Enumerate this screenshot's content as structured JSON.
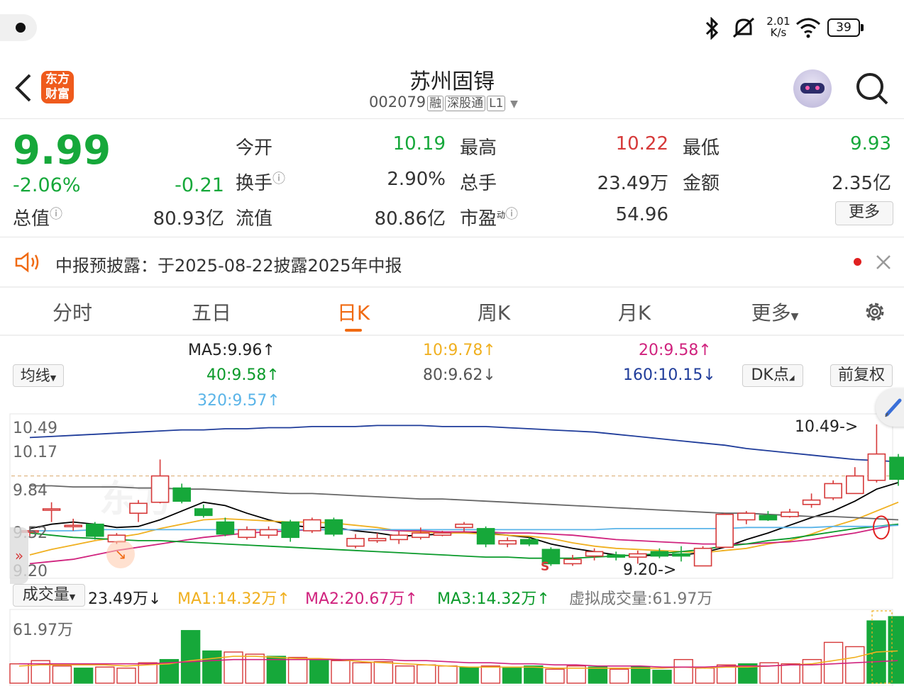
{
  "status_bar": {
    "net_speed_value": "2.01",
    "net_speed_unit": "K/s",
    "battery": "39"
  },
  "header": {
    "logo_line1": "东方",
    "logo_line2": "财富",
    "title": "苏州固锝",
    "code": "002079",
    "tags": [
      "融",
      "深股通",
      "L1"
    ]
  },
  "quote": {
    "price": "9.99",
    "change_pct": "-2.06%",
    "change_abs": "-0.21",
    "open_label": "今开",
    "open": "10.19",
    "high_label": "最高",
    "high": "10.22",
    "low_label": "最低",
    "low": "9.93",
    "turnover_label": "换手",
    "turnover": "2.90%",
    "volume_label": "总手",
    "volume": "23.49万",
    "amount_label": "金额",
    "amount": "2.35亿",
    "mktcap_label": "总值",
    "mktcap": "80.93亿",
    "float_label": "流值",
    "float_cap": "80.86亿",
    "pe_label": "市盈",
    "pe_sup": "动",
    "pe": "54.96",
    "more_label": "更多"
  },
  "notice": {
    "text": "中报预披露：于2025-08-22披露2025年中报"
  },
  "tabs": [
    "分时",
    "五日",
    "日K",
    "周K",
    "月K",
    "更多"
  ],
  "active_tab": "日K",
  "ma_panel": {
    "selector": "均线",
    "ma5": "MA5:9.96",
    "ma10": "10:9.78",
    "ma20": "20:9.58",
    "ma40": "40:9.58",
    "ma80": "80:9.62",
    "ma160": "160:10.15",
    "ma320": "320:9.57",
    "dk_button": "DK点",
    "adjust_button": "前复权"
  },
  "price_axis": [
    "10.49",
    "10.17",
    "9.84",
    "9.52",
    "9.20"
  ],
  "annotations": {
    "high_marker": "10.49->",
    "low_marker": "9.20->",
    "signal": "S"
  },
  "volume_header": {
    "selector": "成交量",
    "vol": "23.49万",
    "ma1": "MA1:14.32万",
    "ma2": "MA2:20.67万",
    "ma3": "MA3:14.32万",
    "virtual": "虚拟成交量:61.97万"
  },
  "volume_axis_max": "61.97万",
  "colors": {
    "up": "#d63a3a",
    "down": "#16a83a",
    "accent": "#f06a12",
    "ma5": "#000000",
    "ma10": "#f0b020",
    "ma20": "#d0237e",
    "ma40": "#0a9a2a",
    "ma80": "#666666",
    "ma160": "#1f3c9a",
    "ma320": "#5ab4e8"
  },
  "chart_data": {
    "type": "candlestick",
    "ylim": [
      9.1,
      10.56
    ],
    "candles": [
      {
        "o": 9.52,
        "c": 9.52,
        "h": 9.56,
        "l": 9.47
      },
      {
        "o": 9.72,
        "c": 9.72,
        "h": 9.78,
        "l": 9.6
      },
      {
        "o": 9.57,
        "c": 9.57,
        "h": 9.63,
        "l": 9.52
      },
      {
        "o": 9.58,
        "c": 9.47,
        "h": 9.6,
        "l": 9.44
      },
      {
        "o": 9.42,
        "c": 9.48,
        "h": 9.5,
        "l": 9.4
      },
      {
        "o": 9.68,
        "c": 9.77,
        "h": 9.8,
        "l": 9.6
      },
      {
        "o": 9.78,
        "c": 10.02,
        "h": 10.17,
        "l": 9.77
      },
      {
        "o": 9.91,
        "c": 9.79,
        "h": 9.95,
        "l": 9.77
      },
      {
        "o": 9.72,
        "c": 9.66,
        "h": 9.76,
        "l": 9.64
      },
      {
        "o": 9.6,
        "c": 9.49,
        "h": 9.64,
        "l": 9.47
      },
      {
        "o": 9.46,
        "c": 9.53,
        "h": 9.56,
        "l": 9.44
      },
      {
        "o": 9.48,
        "c": 9.53,
        "h": 9.56,
        "l": 9.45
      },
      {
        "o": 9.6,
        "c": 9.46,
        "h": 9.62,
        "l": 9.42
      },
      {
        "o": 9.52,
        "c": 9.62,
        "h": 9.64,
        "l": 9.5
      },
      {
        "o": 9.62,
        "c": 9.49,
        "h": 9.64,
        "l": 9.47
      },
      {
        "o": 9.38,
        "c": 9.45,
        "h": 9.49,
        "l": 9.36
      },
      {
        "o": 9.43,
        "c": 9.45,
        "h": 9.5,
        "l": 9.41
      },
      {
        "o": 9.44,
        "c": 9.48,
        "h": 9.52,
        "l": 9.4
      },
      {
        "o": 9.46,
        "c": 9.5,
        "h": 9.55,
        "l": 9.44
      },
      {
        "o": 9.48,
        "c": 9.5,
        "h": 9.52,
        "l": 9.47
      },
      {
        "o": 9.55,
        "c": 9.58,
        "h": 9.6,
        "l": 9.51
      },
      {
        "o": 9.54,
        "c": 9.4,
        "h": 9.56,
        "l": 9.37
      },
      {
        "o": 9.4,
        "c": 9.43,
        "h": 9.46,
        "l": 9.37
      },
      {
        "o": 9.44,
        "c": 9.4,
        "h": 9.46,
        "l": 9.38
      },
      {
        "o": 9.35,
        "c": 9.22,
        "h": 9.37,
        "l": 9.2
      },
      {
        "o": 9.22,
        "c": 9.26,
        "h": 9.3,
        "l": 9.2
      },
      {
        "o": 9.29,
        "c": 9.33,
        "h": 9.36,
        "l": 9.25
      },
      {
        "o": 9.3,
        "c": 9.28,
        "h": 9.33,
        "l": 9.25
      },
      {
        "o": 9.28,
        "c": 9.31,
        "h": 9.34,
        "l": 9.22
      },
      {
        "o": 9.33,
        "c": 9.29,
        "h": 9.36,
        "l": 9.27
      },
      {
        "o": 9.31,
        "c": 9.29,
        "h": 9.38,
        "l": 9.24
      },
      {
        "o": 9.2,
        "c": 9.36,
        "h": 9.38,
        "l": 9.2
      },
      {
        "o": 9.37,
        "c": 9.67,
        "h": 9.68,
        "l": 9.37
      },
      {
        "o": 9.62,
        "c": 9.68,
        "h": 9.7,
        "l": 9.58
      },
      {
        "o": 9.66,
        "c": 9.62,
        "h": 9.7,
        "l": 9.61
      },
      {
        "o": 9.65,
        "c": 9.69,
        "h": 9.72,
        "l": 9.64
      },
      {
        "o": 9.76,
        "c": 9.8,
        "h": 9.86,
        "l": 9.73
      },
      {
        "o": 9.82,
        "c": 9.95,
        "h": 9.98,
        "l": 9.8
      },
      {
        "o": 9.86,
        "c": 10.02,
        "h": 10.1,
        "l": 9.86
      },
      {
        "o": 9.98,
        "c": 10.22,
        "h": 10.49,
        "l": 9.96
      },
      {
        "o": 10.19,
        "c": 9.99,
        "h": 10.22,
        "l": 9.93
      }
    ],
    "ma_lines": {
      "ma5": [
        9.54,
        9.58,
        9.6,
        9.58,
        9.55,
        9.56,
        9.62,
        9.7,
        9.78,
        9.75,
        9.68,
        9.62,
        9.57,
        9.55,
        9.55,
        9.52,
        9.5,
        9.47,
        9.48,
        9.49,
        9.51,
        9.5,
        9.48,
        9.46,
        9.4,
        9.36,
        9.33,
        9.3,
        9.29,
        9.3,
        9.3,
        9.32,
        9.37,
        9.44,
        9.5,
        9.57,
        9.64,
        9.7,
        9.79,
        9.9,
        9.96
      ],
      "ma10": [
        9.3,
        9.35,
        9.39,
        9.43,
        9.46,
        9.49,
        9.54,
        9.58,
        9.62,
        9.63,
        9.62,
        9.61,
        9.6,
        9.6,
        9.59,
        9.57,
        9.55,
        9.52,
        9.51,
        9.5,
        9.5,
        9.49,
        9.48,
        9.47,
        9.45,
        9.41,
        9.38,
        9.36,
        9.35,
        9.34,
        9.33,
        9.32,
        9.34,
        9.36,
        9.4,
        9.43,
        9.49,
        9.56,
        9.62,
        9.7,
        9.78
      ],
      "ma20": [
        9.22,
        9.24,
        9.26,
        9.3,
        9.34,
        9.37,
        9.4,
        9.43,
        9.46,
        9.48,
        9.5,
        9.51,
        9.52,
        9.53,
        9.53,
        9.53,
        9.53,
        9.52,
        9.52,
        9.51,
        9.51,
        9.51,
        9.5,
        9.5,
        9.49,
        9.48,
        9.46,
        9.44,
        9.43,
        9.42,
        9.41,
        9.4,
        9.4,
        9.4,
        9.41,
        9.42,
        9.44,
        9.47,
        9.5,
        9.54,
        9.58
      ],
      "ma40": [
        9.5,
        9.48,
        9.46,
        9.45,
        9.44,
        9.43,
        9.43,
        9.42,
        9.41,
        9.4,
        9.39,
        9.38,
        9.37,
        9.36,
        9.35,
        9.34,
        9.33,
        9.32,
        9.31,
        9.3,
        9.29,
        9.28,
        9.28,
        9.27,
        9.27,
        9.27,
        9.28,
        9.29,
        9.3,
        9.31,
        9.33,
        9.35,
        9.38,
        9.4,
        9.43,
        9.45,
        9.48,
        9.51,
        9.54,
        9.56,
        9.58
      ],
      "ma80": [
        9.93,
        9.93,
        9.92,
        9.92,
        9.92,
        9.91,
        9.91,
        9.9,
        9.9,
        9.89,
        9.88,
        9.87,
        9.86,
        9.86,
        9.85,
        9.84,
        9.83,
        9.82,
        9.81,
        9.81,
        9.8,
        9.79,
        9.78,
        9.77,
        9.76,
        9.75,
        9.74,
        9.73,
        9.72,
        9.71,
        9.7,
        9.69,
        9.68,
        9.68,
        9.67,
        9.66,
        9.65,
        9.65,
        9.64,
        9.63,
        9.62
      ],
      "ma160": [
        10.37,
        10.38,
        10.39,
        10.4,
        10.41,
        10.42,
        10.43,
        10.44,
        10.44,
        10.45,
        10.45,
        10.46,
        10.46,
        10.47,
        10.47,
        10.47,
        10.48,
        10.48,
        10.48,
        10.47,
        10.47,
        10.47,
        10.46,
        10.45,
        10.44,
        10.43,
        10.42,
        10.4,
        10.38,
        10.36,
        10.34,
        10.32,
        10.3,
        10.27,
        10.25,
        10.23,
        10.21,
        10.19,
        10.17,
        10.16,
        10.15
      ],
      "ma320": [
        9.52,
        9.52,
        9.52,
        9.53,
        9.53,
        9.53,
        9.53,
        9.53,
        9.53,
        9.53,
        9.53,
        9.53,
        9.53,
        9.53,
        9.53,
        9.53,
        9.53,
        9.53,
        9.53,
        9.53,
        9.53,
        9.53,
        9.53,
        9.53,
        9.53,
        9.53,
        9.53,
        9.54,
        9.54,
        9.54,
        9.54,
        9.54,
        9.54,
        9.55,
        9.55,
        9.55,
        9.55,
        9.56,
        9.56,
        9.56,
        9.57
      ]
    },
    "volume_wan": [
      18,
      21,
      16,
      14,
      15,
      14,
      19,
      22,
      49,
      30,
      29,
      27,
      25,
      24,
      22,
      21,
      19,
      20,
      16,
      17,
      16,
      15,
      16,
      14,
      16,
      13,
      16,
      15,
      13,
      15,
      12,
      22,
      14,
      17,
      18,
      19,
      18,
      22,
      38,
      34,
      58,
      62
    ],
    "volume_ma": {
      "ma1": [
        16,
        17,
        17,
        17,
        17,
        16,
        17,
        18,
        21,
        23,
        25,
        25,
        24,
        23,
        23,
        22,
        20,
        19,
        18,
        17,
        16,
        15,
        15,
        15,
        15,
        14,
        14,
        14,
        14,
        14,
        14,
        15,
        14,
        15,
        15,
        16,
        17,
        18,
        21,
        24,
        29,
        30
      ],
      "ma2": [
        18,
        18,
        18,
        18,
        18,
        18,
        18,
        19,
        20,
        21,
        22,
        22,
        22,
        22,
        22,
        22,
        22,
        22,
        21,
        21,
        20,
        19,
        19,
        18,
        18,
        17,
        17,
        16,
        16,
        16,
        15,
        15,
        15,
        16,
        16,
        16,
        17,
        17,
        18,
        19,
        20,
        21
      ]
    }
  }
}
